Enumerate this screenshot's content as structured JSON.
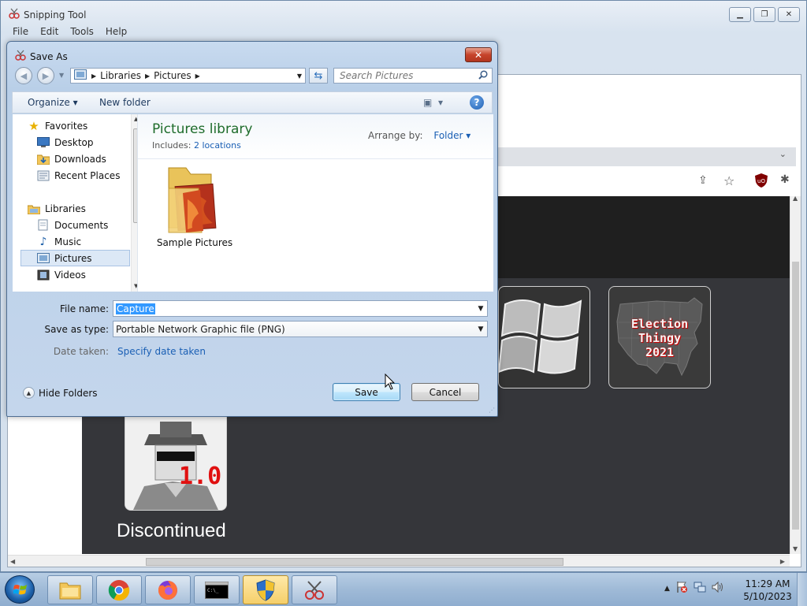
{
  "main_window": {
    "title": "Snipping Tool",
    "menu": [
      "File",
      "Edit",
      "Tools",
      "Help"
    ],
    "controls": {
      "minimize": "▁",
      "restore": "❐",
      "close": "✕"
    }
  },
  "captured_page": {
    "tile_election_text": "Election\nThingy\n2021",
    "spy_badge": "1.0",
    "discontinued_label": "Discontinued"
  },
  "dialog": {
    "title": "Save As",
    "close": "✕",
    "address": [
      "Libraries",
      "Pictures"
    ],
    "search_placeholder": "Search Pictures",
    "toolbar": {
      "organize": "Organize ▾",
      "new_folder": "New folder",
      "help": "?"
    },
    "nav": {
      "favorites": "Favorites",
      "desktop": "Desktop",
      "downloads": "Downloads",
      "recent_places": "Recent Places",
      "libraries": "Libraries",
      "documents": "Documents",
      "music": "Music",
      "pictures": "Pictures",
      "videos": "Videos"
    },
    "library": {
      "title": "Pictures library",
      "includes_label": "Includes:",
      "includes_link": "2 locations",
      "arrange_label": "Arrange by:",
      "arrange_value": "Folder ▾"
    },
    "folder": {
      "label": "Sample Pictures"
    },
    "form": {
      "file_name_label": "File name:",
      "file_name_value": "Capture",
      "save_type_label": "Save as type:",
      "save_type_value": "Portable Network Graphic file (PNG)",
      "date_taken_label": "Date taken:",
      "date_taken_link": "Specify date taken"
    },
    "hide_folders": "Hide Folders",
    "save_button": "Save",
    "cancel_button": "Cancel"
  },
  "taskbar": {
    "clock_time": "11:29 AM",
    "clock_date": "5/10/2023"
  }
}
